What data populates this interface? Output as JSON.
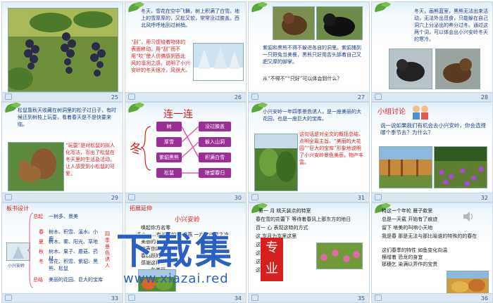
{
  "slides": [
    {
      "num": "25"
    },
    {
      "num": "26",
      "text1": "冬天，雪花在空中飞舞，树上积满了白雪。地上的雪厚厚的，又松又软，常常没过膝盖。西北风呼呼地刮过树梢。",
      "text2": "“刮”，用习惯给着物体的表面移动。用“刮”而不用“吹”使人仿佛感到西北风的凛冽之感，说明了小兴安岭的冬天很冷，风很大。"
    },
    {
      "num": "27",
      "text1": "紫貂和黑熊不得不躲进各自的洞里。紫貂捕到一只野兔当美餐，黑熊只好用舌头舔着自己又肥又厚的脚掌。",
      "text2": "从“不得不”“只好”可以体会到什么？"
    },
    {
      "num": "28",
      "text1": "冬天，画熊蓝室，黑熊无法出来活动，无法外出觅食，只能躲在自己洞穴上分泌出的养分过冬。通过这两个词，可以体会出小兴安岭冬天的寒冷。"
    },
    {
      "num": "29",
      "text1": "松鼠靠秋天收藏在树洞里的松子过日子，有时候还到树枝上玩耍，看着春天是不是快要来临。",
      "text2": "“玩耍”是对松鼠的拟人化写法，写出了松鼠在冬天里的生活及活动，让人感受到小松鼠的可爱。"
    },
    {
      "num": "30",
      "title": "连一连",
      "side": "冬",
      "left": [
        "树",
        "厚雪",
        "紫貂黑熊",
        "松鼠"
      ],
      "right": [
        "没过膝盖",
        "躲入山洞",
        "积满白雪",
        "晾望春归"
      ]
    },
    {
      "num": "31",
      "text1": "小兴安岭一年四季景色诱人，是一座美丽的大花园，也是一座巨大的宝库。",
      "text2": "这句话是对全文的概括总结，点明全篇主旨。“美丽的大花园”“巨大的宝库”形象地说明了小兴安岭景色美丽，物产丰富。"
    },
    {
      "num": "32",
      "heading": "小组讨论",
      "text1": "说一说如果我们有机会去小兴安岭，你会选择哪个季节去？为什么？"
    },
    {
      "num": "33",
      "heading": "板书设计",
      "main": "小兴安岭",
      "rows": [
        {
          "k": "总起",
          "v": "一树多、景美"
        },
        {
          "k": "春",
          "v": "树木、积雪、溪水、小鹿"
        },
        {
          "k": "夏",
          "v": "树木、雾、阳光、草地"
        },
        {
          "k": "秋",
          "v": "树木、果子、蘑菇、药材"
        },
        {
          "k": "冬",
          "v": "雪花、积雪、紫貂、黑熊、松鼠"
        },
        {
          "k": "总结",
          "v": "美丽的花园、巨大的宝库"
        }
      ],
      "side": "四季景色诱人"
    },
    {
      "num": "34",
      "heading": "拓展延伸",
      "title": "小兴安岭",
      "lines": [
        "唤起你方名零",
        "多么……有长绿的松 里燕 一片的白雪之冷",
        "美丽的心跳",
        "欢声你的丹霞",
        "春跳跃的 里 ……",
        "感谢这样林色 ……",
        "……在美丽 ……"
      ]
    },
    {
      "num": "35",
      "lines": [
        "第一 月 桃天装点的特室",
        "春在雪的花蕾下 等待着春风上那东方的地日",
        "百一 心 表现这特的方式",
        "这 岁月为岁里这里",
        "这 是 ……",
        "这 那个 ……",
        "这 你们 ……",
        "这 张 ……"
      ]
    },
    {
      "num": "36",
      "lines": [
        "特这一个年轮 雁子款里",
        "总是一天载 开始有了痕迹",
        "留下 啥美的叫响小天地",
        "我是春 那是无法与那比喻谁的特殊的的春在",
        "这们春季的特性 如鱼变化向温",
        "横增着 恐龙的身宜",
        "那穗乞 染满以弄作的宝贵"
      ]
    }
  ],
  "watermark": {
    "big": "下载集",
    "tag": "专业",
    "url": "www.xiazai.red"
  },
  "colors": {
    "accent": "#1c3f8a",
    "red": "#d81e1e",
    "purple": "#9a2f96",
    "watermark": "#2a5fc4"
  }
}
